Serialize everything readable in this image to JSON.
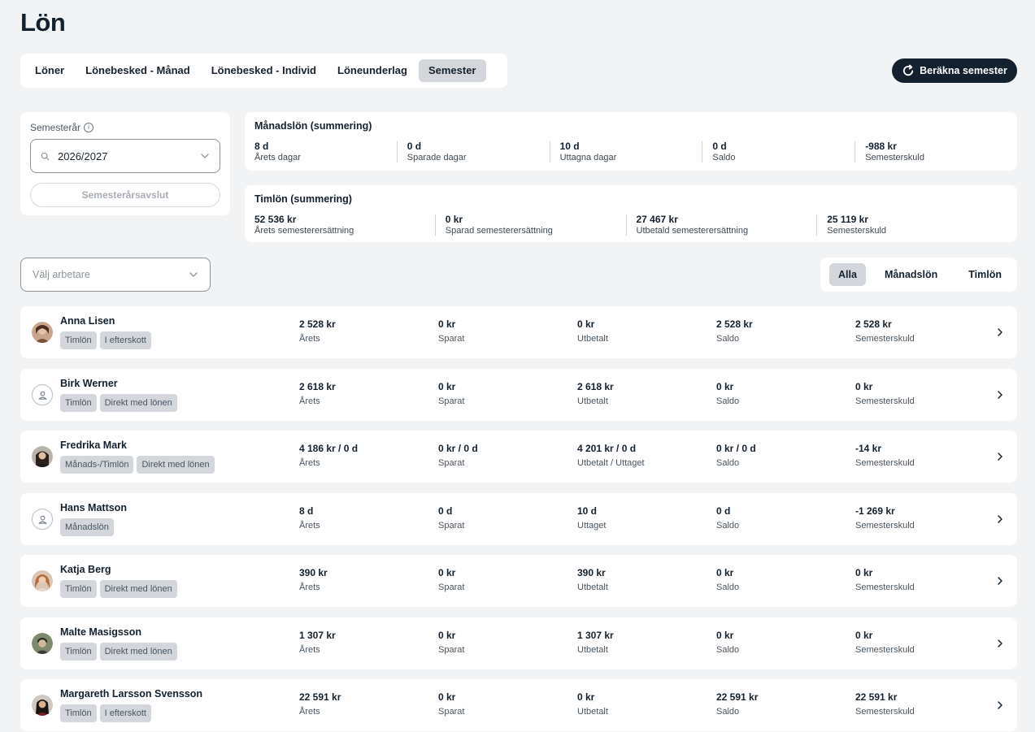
{
  "page": {
    "title": "Lön"
  },
  "tabs": [
    {
      "label": "Löner",
      "active": false
    },
    {
      "label": "Lönebesked - Månad",
      "active": false
    },
    {
      "label": "Lönebesked - Individ",
      "active": false
    },
    {
      "label": "Löneunderlag",
      "active": false
    },
    {
      "label": "Semester",
      "active": true
    }
  ],
  "actions": {
    "calculate_label": "Beräkna semester"
  },
  "year": {
    "label": "Semesterår",
    "value": "2026/2027",
    "close_label": "Semesterårsavslut"
  },
  "monthly_summary": {
    "title": "Månadslön (summering)",
    "cells": [
      {
        "value": "8 d",
        "label": "Årets dagar"
      },
      {
        "value": "0 d",
        "label": "Sparade dagar"
      },
      {
        "value": "10 d",
        "label": "Uttagna dagar"
      },
      {
        "value": "0 d",
        "label": "Saldo"
      },
      {
        "value": "-988 kr",
        "label": "Semesterskuld"
      }
    ]
  },
  "hourly_summary": {
    "title": "Timlön (summering)",
    "cells": [
      {
        "value": "52 536 kr",
        "label": "Årets semesterersättning"
      },
      {
        "value": "0 kr",
        "label": "Sparad semesterersättning"
      },
      {
        "value": "27 467 kr",
        "label": "Utbetald semesterersättning"
      },
      {
        "value": "25 119 kr",
        "label": "Semesterskuld"
      }
    ]
  },
  "worker_select": {
    "placeholder": "Välj arbetare"
  },
  "filters": [
    {
      "label": "Alla",
      "active": true
    },
    {
      "label": "Månadslön",
      "active": false
    },
    {
      "label": "Timlön",
      "active": false
    }
  ],
  "employees": [
    {
      "name": "Anna Lisen",
      "tags": [
        "Timlön",
        "I efterskott"
      ],
      "cols": [
        [
          "2 528 kr",
          "Årets"
        ],
        [
          "0 kr",
          "Sparat"
        ],
        [
          "0 kr",
          "Utbetalt"
        ],
        [
          "2 528 kr",
          "Saldo"
        ],
        [
          "2 528 kr",
          "Semesterskuld"
        ]
      ]
    },
    {
      "name": "Birk Werner",
      "tags": [
        "Timlön",
        "Direkt med lönen"
      ],
      "cols": [
        [
          "2 618 kr",
          "Årets"
        ],
        [
          "0 kr",
          "Sparat"
        ],
        [
          "2 618 kr",
          "Utbetalt"
        ],
        [
          "0 kr",
          "Saldo"
        ],
        [
          "0 kr",
          "Semesterskuld"
        ]
      ]
    },
    {
      "name": "Fredrika Mark",
      "tags": [
        "Månads-/Timlön",
        "Direkt med lönen"
      ],
      "cols": [
        [
          "4 186 kr / 0 d",
          "Årets"
        ],
        [
          "0 kr / 0 d",
          "Sparat"
        ],
        [
          "4 201 kr / 0 d",
          "Utbetalt / Uttaget"
        ],
        [
          "0 kr / 0 d",
          "Saldo"
        ],
        [
          "-14 kr",
          "Semesterskuld"
        ]
      ]
    },
    {
      "name": "Hans Mattson",
      "tags": [
        "Månadslön"
      ],
      "cols": [
        [
          "8 d",
          "Årets"
        ],
        [
          "0 d",
          "Sparat"
        ],
        [
          "10 d",
          "Uttaget"
        ],
        [
          "0 d",
          "Saldo"
        ],
        [
          "-1 269 kr",
          "Semesterskuld"
        ]
      ]
    },
    {
      "name": "Katja Berg",
      "tags": [
        "Timlön",
        "Direkt med lönen"
      ],
      "cols": [
        [
          "390 kr",
          "Årets"
        ],
        [
          "0 kr",
          "Sparat"
        ],
        [
          "390 kr",
          "Utbetalt"
        ],
        [
          "0 kr",
          "Saldo"
        ],
        [
          "0 kr",
          "Semesterskuld"
        ]
      ]
    },
    {
      "name": "Malte Masigsson",
      "tags": [
        "Timlön",
        "Direkt med lönen"
      ],
      "cols": [
        [
          "1 307 kr",
          "Årets"
        ],
        [
          "0 kr",
          "Sparat"
        ],
        [
          "1 307 kr",
          "Utbetalt"
        ],
        [
          "0 kr",
          "Saldo"
        ],
        [
          "0 kr",
          "Semesterskuld"
        ]
      ]
    },
    {
      "name": "Margareth Larsson Svensson",
      "tags": [
        "Timlön",
        "I efterskott"
      ],
      "cols": [
        [
          "22 591 kr",
          "Årets"
        ],
        [
          "0 kr",
          "Sparat"
        ],
        [
          "0 kr",
          "Utbetalt"
        ],
        [
          "22 591 kr",
          "Saldo"
        ],
        [
          "22 591 kr",
          "Semesterskuld"
        ]
      ]
    }
  ]
}
